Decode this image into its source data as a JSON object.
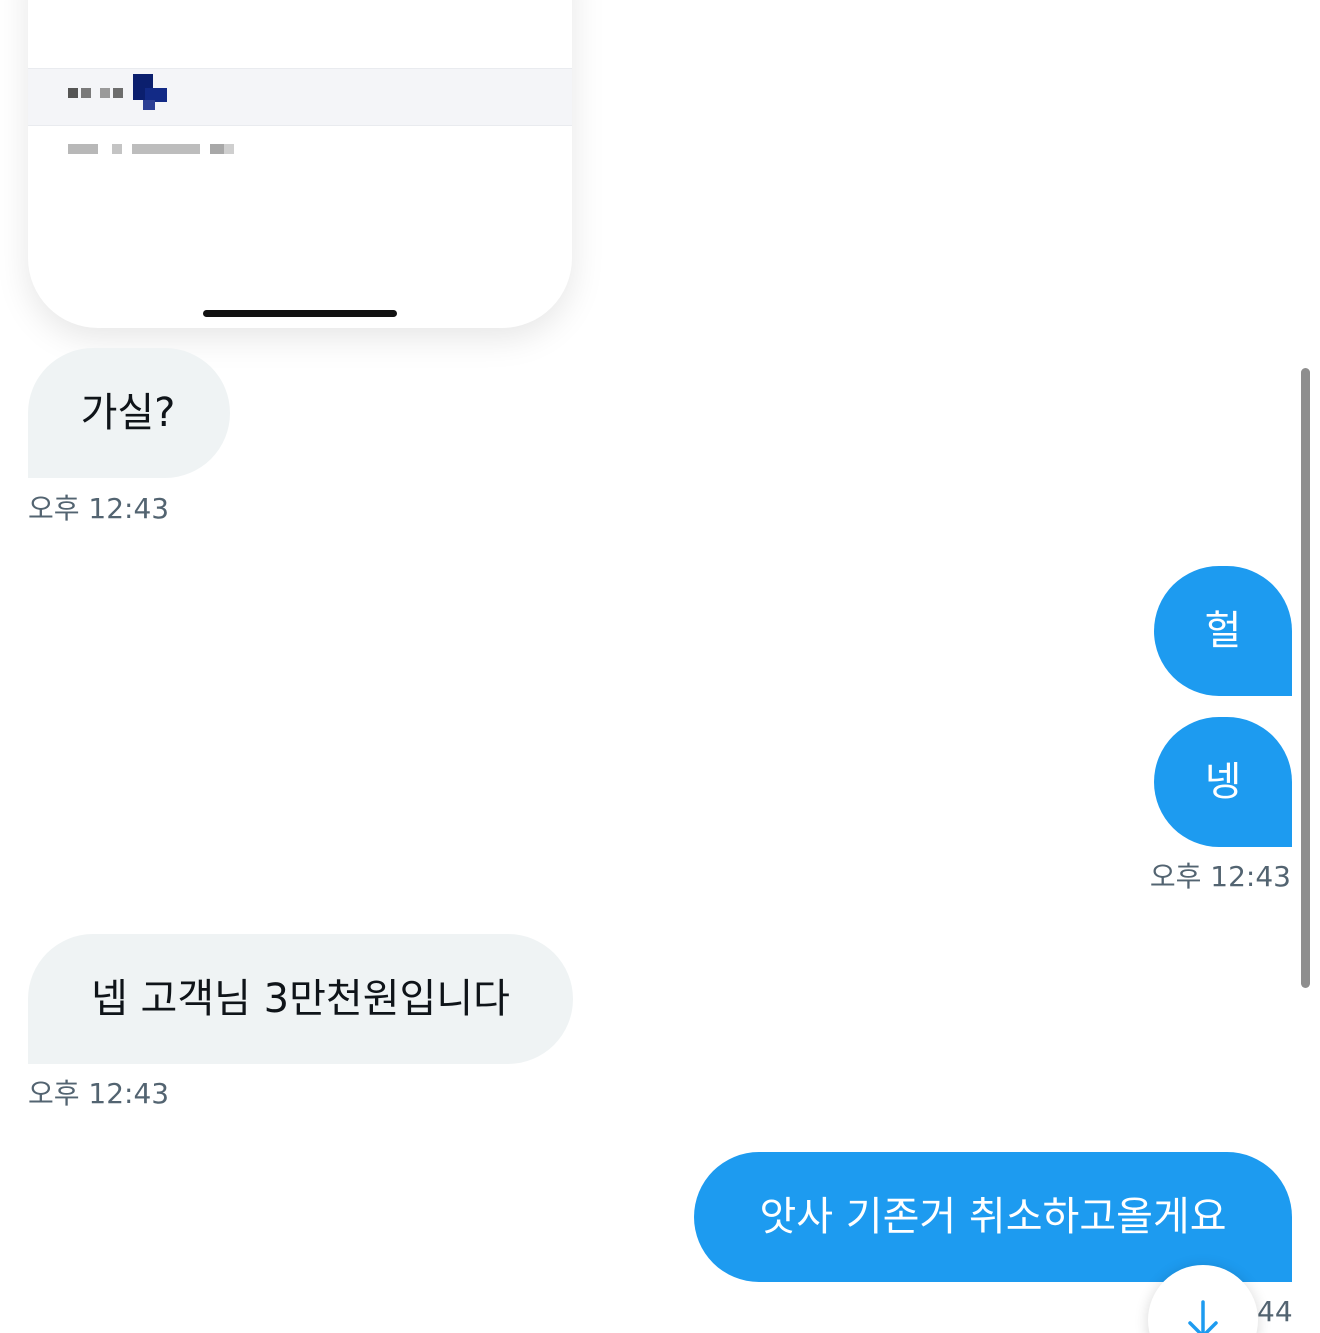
{
  "conversation": {
    "messages": [
      {
        "direction": "in",
        "text": "가실?",
        "time": "오후 12:43"
      },
      {
        "direction": "out",
        "text": "헐"
      },
      {
        "direction": "out",
        "text": "넹",
        "time": "오후 12:43"
      },
      {
        "direction": "in",
        "text": "넵 고객님 3만천원입니다",
        "time": "오후 12:43"
      },
      {
        "direction": "out",
        "text": "앗사 기존거 취소하고올게요",
        "time_partial": "44"
      }
    ]
  },
  "icons": {
    "scroll_to_bottom": "arrow-down-icon"
  },
  "colors": {
    "outgoing_bubble": "#1d9bf0",
    "incoming_bubble": "#eff3f4",
    "timestamp": "#536471",
    "accent": "#1d9bf0"
  }
}
